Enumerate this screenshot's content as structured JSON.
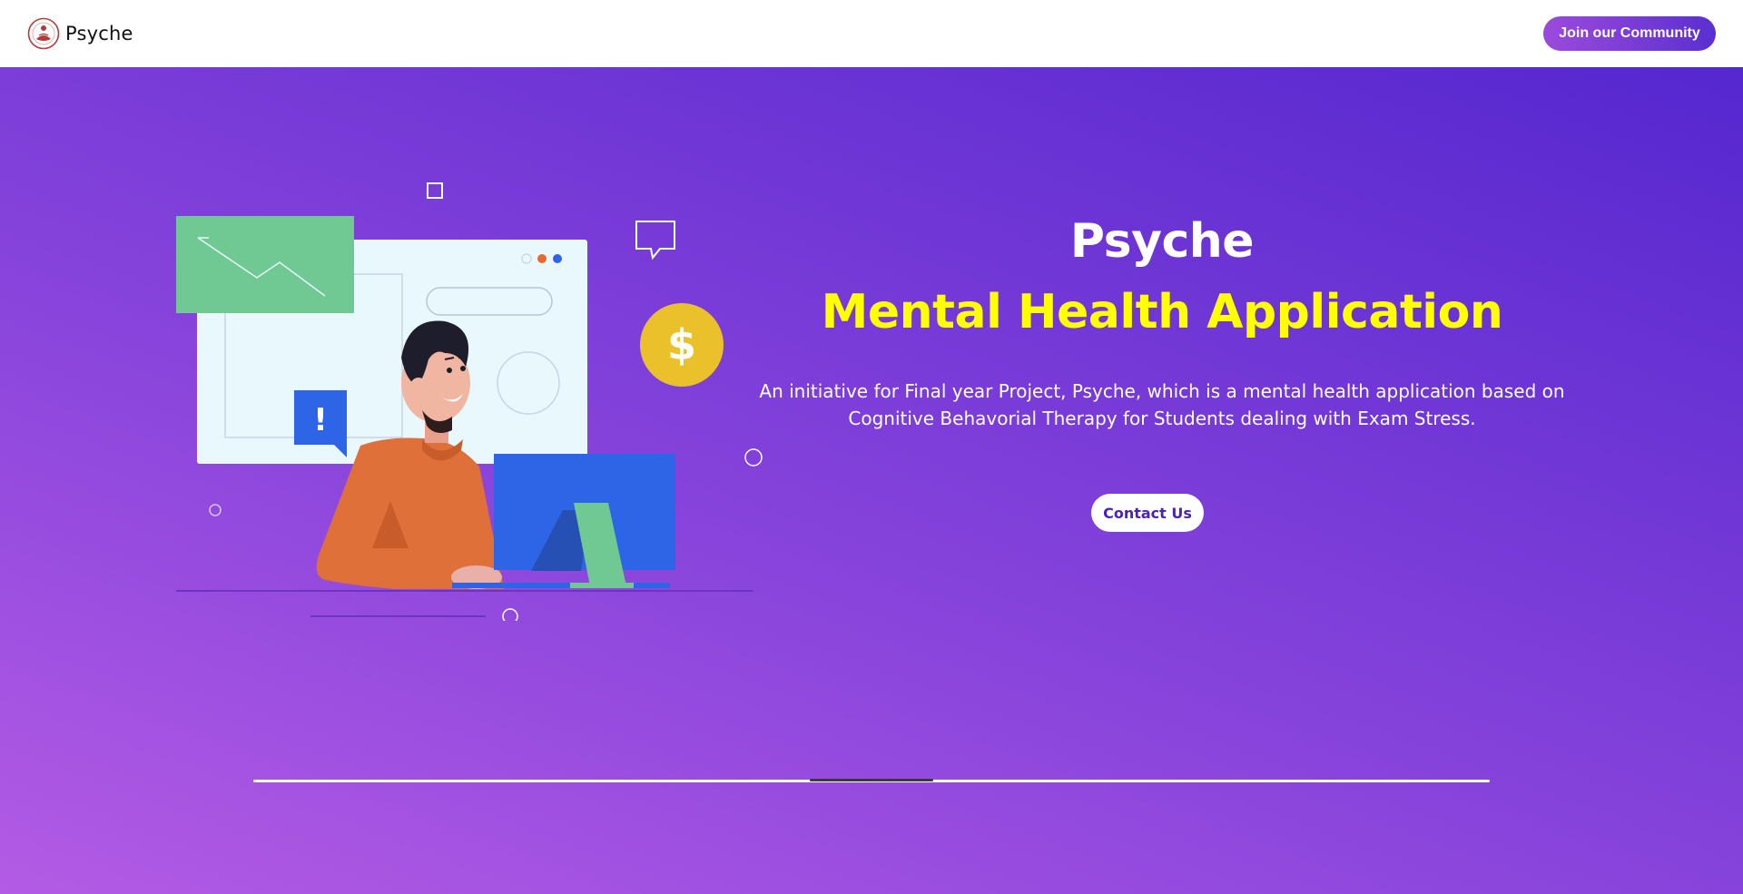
{
  "header": {
    "brand_name": "Psyche",
    "join_label": "Join our Community"
  },
  "hero": {
    "title": "Psyche",
    "subtitle": "Mental Health Application",
    "description": "An initiative for Final year Project, Psyche, which is a mental health application based on Cognitive Behavorial Therapy for Students dealing with Exam Stress.",
    "contact_label": "Contact Us"
  },
  "illustration": {
    "coin_symbol": "$",
    "alert_symbol": "!"
  },
  "carousel": {
    "position_fraction": 0.45,
    "thumb_fraction": 0.1
  },
  "colors": {
    "brand_gradient_start": "#b35be5",
    "brand_gradient_end": "#5527cf",
    "subtitle": "#ffff00",
    "button_text": "#4b22b8"
  },
  "icons": {
    "logo": "psyche-logo-icon",
    "coin": "dollar-coin-icon",
    "alert": "alert-bubble-icon",
    "chat": "chat-bubble-icon"
  }
}
